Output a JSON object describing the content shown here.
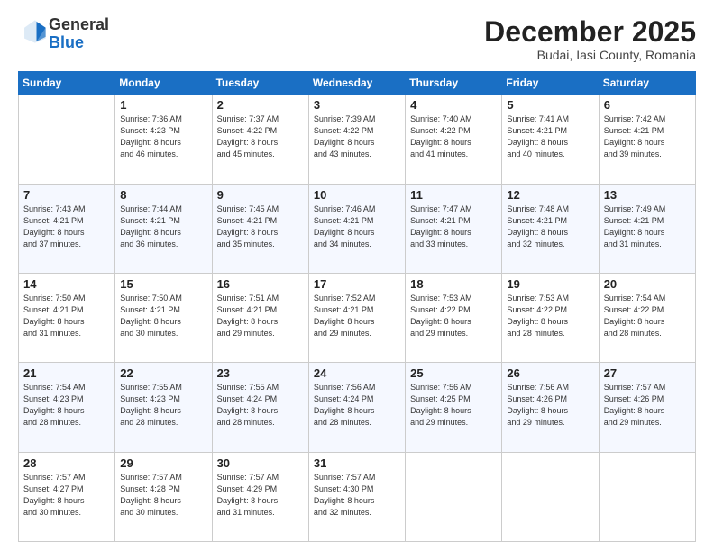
{
  "header": {
    "logo_line1": "General",
    "logo_line2": "Blue",
    "month": "December 2025",
    "location": "Budai, Iasi County, Romania"
  },
  "weekdays": [
    "Sunday",
    "Monday",
    "Tuesday",
    "Wednesday",
    "Thursday",
    "Friday",
    "Saturday"
  ],
  "weeks": [
    [
      {
        "day": "",
        "info": ""
      },
      {
        "day": "1",
        "info": "Sunrise: 7:36 AM\nSunset: 4:23 PM\nDaylight: 8 hours\nand 46 minutes."
      },
      {
        "day": "2",
        "info": "Sunrise: 7:37 AM\nSunset: 4:22 PM\nDaylight: 8 hours\nand 45 minutes."
      },
      {
        "day": "3",
        "info": "Sunrise: 7:39 AM\nSunset: 4:22 PM\nDaylight: 8 hours\nand 43 minutes."
      },
      {
        "day": "4",
        "info": "Sunrise: 7:40 AM\nSunset: 4:22 PM\nDaylight: 8 hours\nand 41 minutes."
      },
      {
        "day": "5",
        "info": "Sunrise: 7:41 AM\nSunset: 4:21 PM\nDaylight: 8 hours\nand 40 minutes."
      },
      {
        "day": "6",
        "info": "Sunrise: 7:42 AM\nSunset: 4:21 PM\nDaylight: 8 hours\nand 39 minutes."
      }
    ],
    [
      {
        "day": "7",
        "info": "Sunrise: 7:43 AM\nSunset: 4:21 PM\nDaylight: 8 hours\nand 37 minutes."
      },
      {
        "day": "8",
        "info": "Sunrise: 7:44 AM\nSunset: 4:21 PM\nDaylight: 8 hours\nand 36 minutes."
      },
      {
        "day": "9",
        "info": "Sunrise: 7:45 AM\nSunset: 4:21 PM\nDaylight: 8 hours\nand 35 minutes."
      },
      {
        "day": "10",
        "info": "Sunrise: 7:46 AM\nSunset: 4:21 PM\nDaylight: 8 hours\nand 34 minutes."
      },
      {
        "day": "11",
        "info": "Sunrise: 7:47 AM\nSunset: 4:21 PM\nDaylight: 8 hours\nand 33 minutes."
      },
      {
        "day": "12",
        "info": "Sunrise: 7:48 AM\nSunset: 4:21 PM\nDaylight: 8 hours\nand 32 minutes."
      },
      {
        "day": "13",
        "info": "Sunrise: 7:49 AM\nSunset: 4:21 PM\nDaylight: 8 hours\nand 31 minutes."
      }
    ],
    [
      {
        "day": "14",
        "info": "Sunrise: 7:50 AM\nSunset: 4:21 PM\nDaylight: 8 hours\nand 31 minutes."
      },
      {
        "day": "15",
        "info": "Sunrise: 7:50 AM\nSunset: 4:21 PM\nDaylight: 8 hours\nand 30 minutes."
      },
      {
        "day": "16",
        "info": "Sunrise: 7:51 AM\nSunset: 4:21 PM\nDaylight: 8 hours\nand 29 minutes."
      },
      {
        "day": "17",
        "info": "Sunrise: 7:52 AM\nSunset: 4:21 PM\nDaylight: 8 hours\nand 29 minutes."
      },
      {
        "day": "18",
        "info": "Sunrise: 7:53 AM\nSunset: 4:22 PM\nDaylight: 8 hours\nand 29 minutes."
      },
      {
        "day": "19",
        "info": "Sunrise: 7:53 AM\nSunset: 4:22 PM\nDaylight: 8 hours\nand 28 minutes."
      },
      {
        "day": "20",
        "info": "Sunrise: 7:54 AM\nSunset: 4:22 PM\nDaylight: 8 hours\nand 28 minutes."
      }
    ],
    [
      {
        "day": "21",
        "info": "Sunrise: 7:54 AM\nSunset: 4:23 PM\nDaylight: 8 hours\nand 28 minutes."
      },
      {
        "day": "22",
        "info": "Sunrise: 7:55 AM\nSunset: 4:23 PM\nDaylight: 8 hours\nand 28 minutes."
      },
      {
        "day": "23",
        "info": "Sunrise: 7:55 AM\nSunset: 4:24 PM\nDaylight: 8 hours\nand 28 minutes."
      },
      {
        "day": "24",
        "info": "Sunrise: 7:56 AM\nSunset: 4:24 PM\nDaylight: 8 hours\nand 28 minutes."
      },
      {
        "day": "25",
        "info": "Sunrise: 7:56 AM\nSunset: 4:25 PM\nDaylight: 8 hours\nand 29 minutes."
      },
      {
        "day": "26",
        "info": "Sunrise: 7:56 AM\nSunset: 4:26 PM\nDaylight: 8 hours\nand 29 minutes."
      },
      {
        "day": "27",
        "info": "Sunrise: 7:57 AM\nSunset: 4:26 PM\nDaylight: 8 hours\nand 29 minutes."
      }
    ],
    [
      {
        "day": "28",
        "info": "Sunrise: 7:57 AM\nSunset: 4:27 PM\nDaylight: 8 hours\nand 30 minutes."
      },
      {
        "day": "29",
        "info": "Sunrise: 7:57 AM\nSunset: 4:28 PM\nDaylight: 8 hours\nand 30 minutes."
      },
      {
        "day": "30",
        "info": "Sunrise: 7:57 AM\nSunset: 4:29 PM\nDaylight: 8 hours\nand 31 minutes."
      },
      {
        "day": "31",
        "info": "Sunrise: 7:57 AM\nSunset: 4:30 PM\nDaylight: 8 hours\nand 32 minutes."
      },
      {
        "day": "",
        "info": ""
      },
      {
        "day": "",
        "info": ""
      },
      {
        "day": "",
        "info": ""
      }
    ]
  ]
}
